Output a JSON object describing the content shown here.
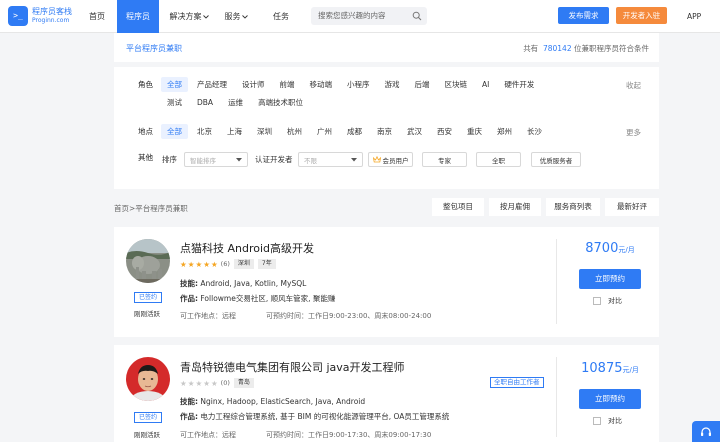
{
  "nav": {
    "logo_mark": ">_",
    "logo_cn": "程序员客栈",
    "logo_en": "Proginn.com",
    "items": [
      {
        "label": "首页"
      },
      {
        "label": "程序员"
      },
      {
        "label": "解决方案"
      },
      {
        "label": "服务"
      },
      {
        "label": "任务"
      }
    ],
    "search_placeholder": "搜索您感兴趣的内容",
    "publish": "发布需求",
    "developer_entry": "开发者入驻",
    "app": "APP"
  },
  "header": {
    "title": "平台程序员兼职",
    "count_prefix": "共有",
    "count": "780142",
    "count_suffix": "位兼职程序员符合条件"
  },
  "filters": {
    "role_label": "角色",
    "roles_row1": [
      "全部",
      "产品经理",
      "设计师",
      "前端",
      "移动端",
      "小程序",
      "游戏",
      "后端",
      "区块链",
      "AI",
      "硬件开发"
    ],
    "roles_row2": [
      "测试",
      "DBA",
      "运维",
      "高端技术职位"
    ],
    "collapse": "收起",
    "location_label": "地点",
    "locations": [
      "全部",
      "北京",
      "上海",
      "深圳",
      "杭州",
      "广州",
      "成都",
      "南京",
      "武汉",
      "西安",
      "重庆",
      "郑州",
      "长沙"
    ],
    "more": "更多",
    "other_label": "其他",
    "sort_label": "排序",
    "sort_value": "智能排序",
    "cert_label": "认证开发者",
    "cert_value": "不限",
    "member": "会员用户",
    "expert": "专家",
    "fulltime": "全职",
    "quality": "优质服务者"
  },
  "breadcrumb": "首页>平台程序员兼职",
  "tabs": [
    {
      "label": "整包项目"
    },
    {
      "label": "按月雇佣"
    },
    {
      "label": "服务商列表"
    },
    {
      "label": "最新好评"
    }
  ],
  "cards": [
    {
      "name": "点猫科技 Android高级开发",
      "stars": 5,
      "rating_count": "(6)",
      "city": "深圳",
      "years": "7年",
      "skills_label": "技能:",
      "skills": "Android, Java, Kotlin, MySQL",
      "works_label": "作品:",
      "works": "Followme交易社区, 顺风车管家, 聚能赚",
      "work_place": "可工作地点：远程",
      "reserve_time": "可预约时间：工作日9:00-23:00、周末08:00-24:00",
      "signed": "已签约",
      "active": "刚刚活跃",
      "price": "8700",
      "price_unit": "元/月",
      "reserve": "立即预约",
      "compare": "对比"
    },
    {
      "name": "青岛特锐德电气集团有限公司 java开发工程师",
      "stars": 0,
      "rating_count": "(0)",
      "city": "青岛",
      "fulltime": "全职自由工作者",
      "skills_label": "技能:",
      "skills": "Nginx, Hadoop, ElasticSearch, Java, Android",
      "works_label": "作品:",
      "works": "电力工程综合管理系统, 基于 BIM 的可视化能源管理平台, OA员工管理系统",
      "work_place": "可工作地点：远程",
      "reserve_time": "可预约时间：工作日9:00-17:30、周末09:00-17:30",
      "signed": "已签约",
      "active": "刚刚活跃",
      "price": "10875",
      "price_unit": "元/月",
      "reserve": "立即预约",
      "compare": "对比"
    }
  ],
  "colors": {
    "primary": "#2f7bf4",
    "orange": "#f58a3c",
    "star": "#f5a623"
  }
}
